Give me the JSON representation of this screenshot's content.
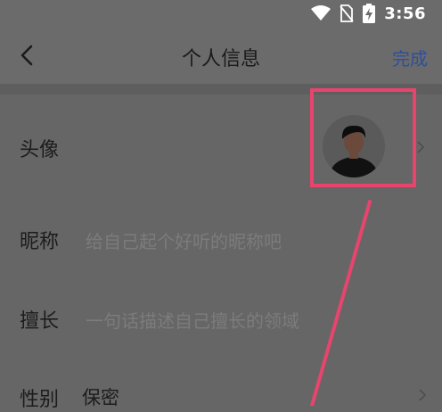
{
  "status_bar": {
    "time": "3:56"
  },
  "header": {
    "title": "个人信息",
    "done_label": "完成"
  },
  "rows": {
    "avatar": {
      "label": "头像"
    },
    "nickname": {
      "label": "昵称",
      "placeholder": "给自己起个好听的昵称吧"
    },
    "expertise": {
      "label": "擅长",
      "placeholder": "一句话描述自己擅长的领域"
    },
    "gender": {
      "label": "性别",
      "value": "保密"
    }
  },
  "colors": {
    "accent": "#2e4f9c",
    "annotation": "#e8446e",
    "overlay_bg": "#666666"
  },
  "icons": [
    "back-arrow-icon",
    "wifi-icon",
    "no-sim-icon",
    "battery-charging-icon",
    "chevron-right-icon"
  ]
}
